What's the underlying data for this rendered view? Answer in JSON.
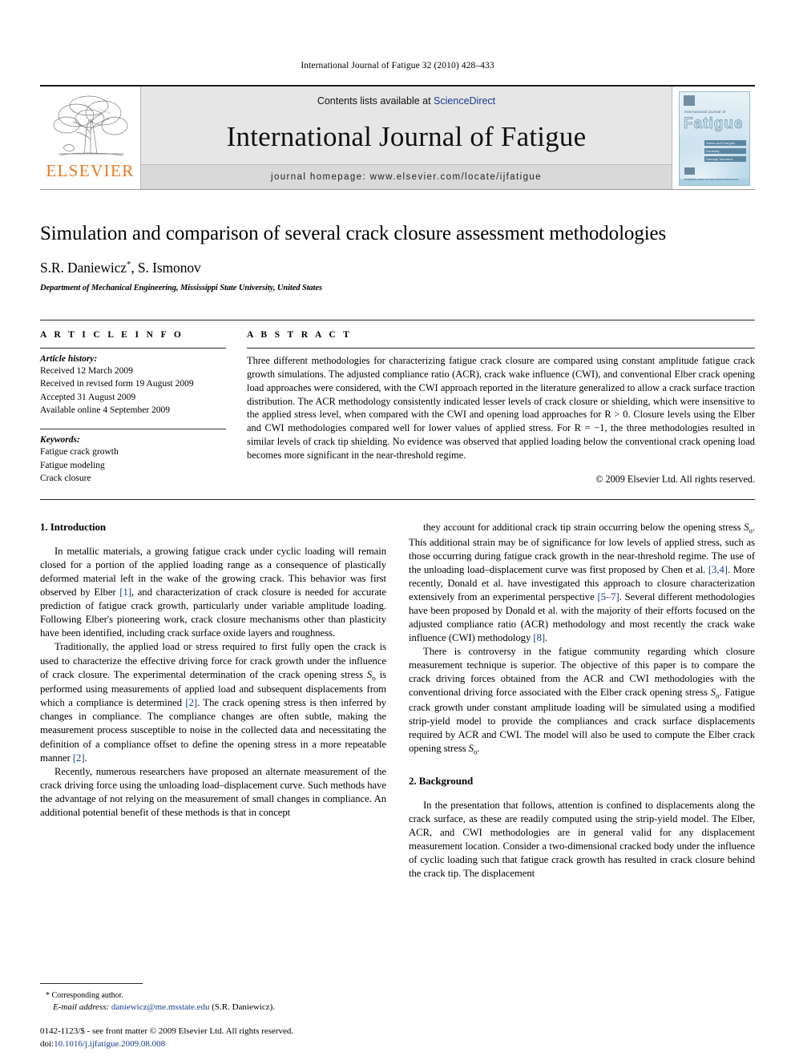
{
  "running_head": "International Journal of Fatigue 32 (2010) 428–433",
  "masthead": {
    "contents_prefix": "Contents lists available at ",
    "sciencedirect": "ScienceDirect",
    "journal_title": "International Journal of Fatigue",
    "homepage": "journal homepage: www.elsevier.com/locate/ijfatigue",
    "publisher_name": "ELSEVIER",
    "cover": {
      "sub_title": "international journal of",
      "title": "Fatigue",
      "bars": [
        "Stress and Energies",
        "Durability",
        "Damage Tolerance"
      ],
      "footer": "Available online at www.sciencedirect.com"
    },
    "colors": {
      "elsevier_orange": "#e87722",
      "link_blue": "#1a3a8f",
      "masthead_gray": "#e6e6e6",
      "homepage_strip_gray": "#d9d9d9"
    }
  },
  "title_block": {
    "title": "Simulation and comparison of several crack closure assessment methodologies",
    "authors_pre": "S.R. Daniewicz",
    "corresponding_marker": "*",
    "authors_post": ", S. Ismonov",
    "affiliation": "Department of Mechanical Engineering, Mississippi State University, United States"
  },
  "article_info": {
    "label": "A R T I C L E    I N F O",
    "history_head": "Article history:",
    "history": [
      "Received 12 March 2009",
      "Received in revised form 19 August 2009",
      "Accepted 31 August 2009",
      "Available online 4 September 2009"
    ],
    "keywords_head": "Keywords:",
    "keywords": [
      "Fatigue crack growth",
      "Fatigue modeling",
      "Crack closure"
    ]
  },
  "abstract": {
    "label": "A B S T R A C T",
    "text": "Three different methodologies for characterizing fatigue crack closure are compared using constant amplitude fatigue crack growth simulations. The adjusted compliance ratio (ACR), crack wake influence (CWI), and conventional Elber crack opening load approaches were considered, with the CWI approach reported in the literature generalized to allow a crack surface traction distribution. The ACR methodology consistently indicated lesser levels of crack closure or shielding, which were insensitive to the applied stress level, when compared with the CWI and opening load approaches for R > 0. Closure levels using the Elber and CWI methodologies compared well for lower values of applied stress. For R = −1, the three methodologies resulted in similar levels of crack tip shielding. No evidence was observed that applied loading below the conventional crack opening load becomes more significant in the near-threshold regime.",
    "copyright": "© 2009 Elsevier Ltd. All rights reserved."
  },
  "body": {
    "section1_head": "1. Introduction",
    "section2_head": "2. Background",
    "left_paragraphs": [
      {
        "parts": [
          {
            "t": "In metallic materials, a growing fatigue crack under cyclic loading will remain closed for a portion of the applied loading range as a consequence of plastically deformed material left in the wake of the growing crack. This behavior was first observed by Elber "
          },
          {
            "t": "[1]",
            "style": "ref"
          },
          {
            "t": ", and characterization of crack closure is needed for accurate prediction of fatigue crack growth, particularly under variable amplitude loading. Following Elber's pioneering work, crack closure mechanisms other than plasticity have been identified, including crack surface oxide layers and roughness."
          }
        ]
      },
      {
        "parts": [
          {
            "t": "Traditionally, the applied load or stress required to first fully open the crack is used to characterize the effective driving force for crack growth under the influence of crack closure. The experimental determination of the crack opening stress "
          },
          {
            "t": "S",
            "style": "italic"
          },
          {
            "t": "o",
            "style": "sub"
          },
          {
            "t": " is performed using measurements of applied load and subsequent displacements from which a compliance is determined "
          },
          {
            "t": "[2]",
            "style": "ref"
          },
          {
            "t": ". The crack opening stress is then inferred by changes in compliance. The compliance changes are often subtle, making the measurement process susceptible to noise in the collected data and necessitating the definition of a compliance offset to define the opening stress in a more repeatable manner "
          },
          {
            "t": "[2]",
            "style": "ref"
          },
          {
            "t": "."
          }
        ]
      },
      {
        "parts": [
          {
            "t": "Recently, numerous researchers have proposed an alternate measurement of the crack driving force using the unloading load–displacement curve. Such methods have the advantage of not relying on the measurement of small changes in compliance. An additional potential benefit of these methods is that in concept"
          }
        ]
      }
    ],
    "right_paragraphs": [
      {
        "parts": [
          {
            "t": "they account for additional crack tip strain occurring below the opening stress "
          },
          {
            "t": "S",
            "style": "italic"
          },
          {
            "t": "o",
            "style": "sub"
          },
          {
            "t": ". This additional strain may be of significance for low levels of applied stress, such as those occurring during fatigue crack growth in the near-threshold regime. The use of the unloading load–displacement curve was first proposed by Chen et al. "
          },
          {
            "t": "[3,4]",
            "style": "ref"
          },
          {
            "t": ". More recently, Donald et al. have investigated this approach to closure characterization extensively from an experimental perspective "
          },
          {
            "t": "[5–7]",
            "style": "ref"
          },
          {
            "t": ". Several different methodologies have been proposed by Donald et al. with the majority of their efforts focused on the adjusted compliance ratio (ACR) methodology and most recently the crack wake influence (CWI) methodology "
          },
          {
            "t": "[8]",
            "style": "ref"
          },
          {
            "t": "."
          }
        ]
      },
      {
        "parts": [
          {
            "t": "There is controversy in the fatigue community regarding which closure measurement technique is superior. The objective of this paper is to compare the crack driving forces obtained from the ACR and CWI methodologies with the conventional driving force associated with the Elber crack opening stress "
          },
          {
            "t": "S",
            "style": "italic"
          },
          {
            "t": "o",
            "style": "sub"
          },
          {
            "t": ". Fatigue crack growth under constant amplitude loading will be simulated using a modified strip-yield model to provide the compliances and crack surface displacements required by ACR and CWI. The model will also be used to compute the Elber crack opening stress "
          },
          {
            "t": "S",
            "style": "italic"
          },
          {
            "t": "o",
            "style": "sub"
          },
          {
            "t": "."
          }
        ]
      }
    ],
    "background_paragraphs": [
      {
        "parts": [
          {
            "t": "In the presentation that follows, attention is confined to displacements along the crack surface, as these are readily computed using the strip-yield model. The Elber, ACR, and CWI methodologies are in general valid for any displacement measurement location. Consider a two-dimensional cracked body under the influence of cyclic loading such that fatigue crack growth has resulted in crack closure behind the crack tip. The displacement"
          }
        ]
      }
    ]
  },
  "footnote": {
    "corresponding": "* Corresponding author.",
    "email_label": "E-mail address:",
    "email": "daniewicz@me.msstate.edu",
    "email_owner": "(S.R. Daniewicz)."
  },
  "imprint": {
    "line1": "0142-1123/$ - see front matter © 2009 Elsevier Ltd. All rights reserved.",
    "doi_label": "doi:",
    "doi": "10.1016/j.ijfatigue.2009.08.008"
  }
}
